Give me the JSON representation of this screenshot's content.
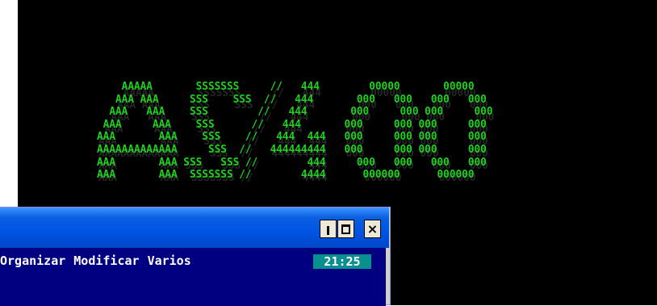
{
  "console": {
    "banner_lines": [
      "    AAAAA       SSSSSSS     //   444        00000       00000",
      "   AAA AAA     SSS    SSS  //   444       000   000   000   000",
      "  AAA   AAA    SSS        //   444       000     000 000     000",
      " AAA     AAA    SSS      //   444       000     000 000     000",
      "AAA       AAA    SSS    //   444  444   000     000 000     000",
      "AAAAAAAAAAAAA     SSS  //   444444444   000     000 000     000",
      "AAA       AAA SSS   SSS //        444     000   000   000   000",
      "AAA       AAA  SSSSSSS //        4444      000000      000000"
    ],
    "text_color": "#1fd11f",
    "background_color": "#000000"
  },
  "window": {
    "controls": {
      "minimize_icon": "minimize-icon",
      "maximize_icon": "maximize-icon",
      "close_icon": "close-icon",
      "close_glyph": "×"
    },
    "menu": [
      "Organizar",
      "Modificar",
      "Varios"
    ],
    "clock": "21:25",
    "colors": {
      "titlebar": "#0054e3",
      "client_background": "#000080",
      "clock_background": "#0a8f8f"
    }
  }
}
